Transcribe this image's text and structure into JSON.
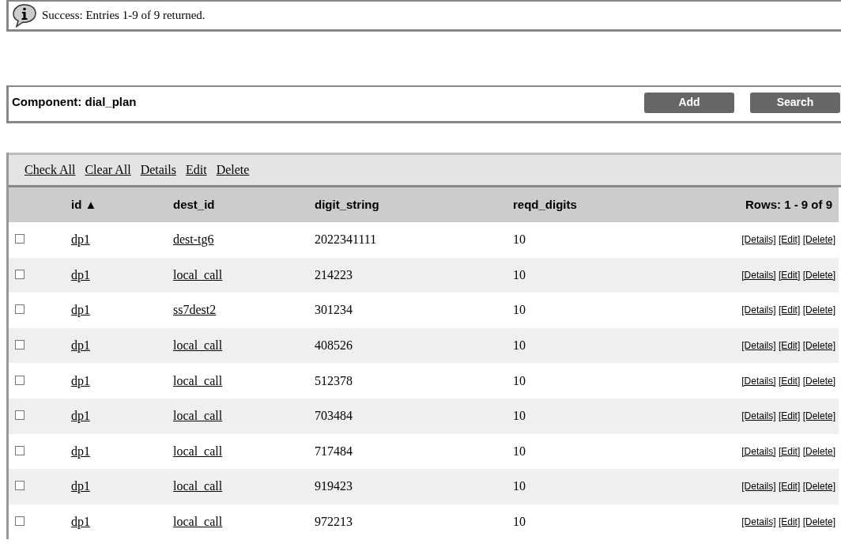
{
  "message": {
    "text": "Success: Entries 1-9 of 9 returned."
  },
  "component": {
    "title": "Component: dial_plan",
    "buttons": [
      "Add",
      "Search"
    ]
  },
  "toolbar": [
    "Check All",
    "Clear All",
    "Details",
    "Edit",
    "Delete"
  ],
  "table": {
    "columns": [
      "id ▲",
      "dest_id",
      "digit_string",
      "reqd_digits"
    ],
    "rows_label": "Rows: 1 - 9 of 9",
    "rows": [
      {
        "checked": false,
        "id": "dp1",
        "dest_id": "dest-tg6",
        "digit_string": "2022341111",
        "reqd_digits": "10",
        "actions": [
          "[Details]",
          "[Edit]",
          "[Delete]"
        ]
      },
      {
        "checked": false,
        "id": "dp1",
        "dest_id": "local_call",
        "digit_string": "214223",
        "reqd_digits": "10",
        "actions": [
          "[Details]",
          "[Edit]",
          "[Delete]"
        ]
      },
      {
        "checked": false,
        "id": "dp1",
        "dest_id": "ss7dest2",
        "digit_string": "301234",
        "reqd_digits": "10",
        "actions": [
          "[Details]",
          "[Edit]",
          "[Delete]"
        ]
      },
      {
        "checked": false,
        "id": "dp1",
        "dest_id": "local_call",
        "digit_string": "408526",
        "reqd_digits": "10",
        "actions": [
          "[Details]",
          "[Edit]",
          "[Delete]"
        ]
      },
      {
        "checked": false,
        "id": "dp1",
        "dest_id": "local_call",
        "digit_string": "512378",
        "reqd_digits": "10",
        "actions": [
          "[Details]",
          "[Edit]",
          "[Delete]"
        ]
      },
      {
        "checked": false,
        "id": "dp1",
        "dest_id": "local_call",
        "digit_string": "703484",
        "reqd_digits": "10",
        "actions": [
          "[Details]",
          "[Edit]",
          "[Delete]"
        ]
      },
      {
        "checked": false,
        "id": "dp1",
        "dest_id": "local_call",
        "digit_string": "717484",
        "reqd_digits": "10",
        "actions": [
          "[Details]",
          "[Edit]",
          "[Delete]"
        ]
      },
      {
        "checked": false,
        "id": "dp1",
        "dest_id": "local_call",
        "digit_string": "919423",
        "reqd_digits": "10",
        "actions": [
          "[Details]",
          "[Edit]",
          "[Delete]"
        ]
      },
      {
        "checked": false,
        "id": "dp1",
        "dest_id": "local_call",
        "digit_string": "972213",
        "reqd_digits": "10",
        "actions": [
          "[Details]",
          "[Edit]",
          "[Delete]"
        ]
      }
    ]
  }
}
